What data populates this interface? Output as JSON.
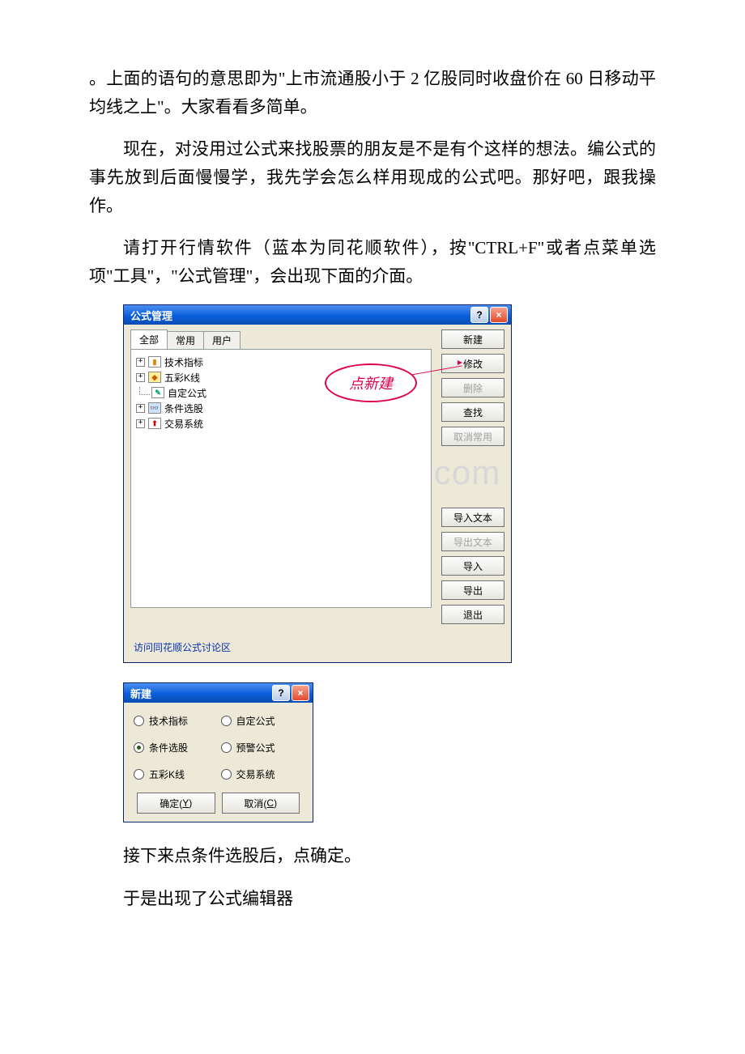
{
  "paragraphs": {
    "p1": "。上面的语句的意思即为\"上市流通股小于 2 亿股同时收盘价在 60 日移动平均线之上\"。大家看看多简单。",
    "p2": "现在，对没用过公式来找股票的朋友是不是有个这样的想法。编公式的事先放到后面慢慢学，我先学会怎么样用现成的公式吧。那好吧，跟我操作。",
    "p3": "请打开行情软件（蓝本为同花顺软件），按\"CTRL+F\"或者点菜单选项\"工具\"，\"公式管理\"，会出现下面的介面。",
    "p4": "接下来点条件选股后，点确定。",
    "p5": "于是出现了公式编辑器"
  },
  "watermark": "www.bdocx.com",
  "dialog1": {
    "title": "公式管理",
    "tabs": [
      "全部",
      "常用",
      "用户"
    ],
    "active_tab_index": 0,
    "tree": [
      {
        "label": "技术指标",
        "icon_class": "ico-chart",
        "has_children": true
      },
      {
        "label": "五彩K线",
        "icon_class": "ico-color",
        "has_children": true
      },
      {
        "label": "自定公式",
        "icon_class": "ico-edit",
        "has_children": false
      },
      {
        "label": "条件选股",
        "icon_class": "ico-find",
        "has_children": true
      },
      {
        "label": "交易系统",
        "icon_class": "ico-trade",
        "has_children": true
      }
    ],
    "group1": [
      {
        "label": "新建",
        "disabled": false
      },
      {
        "label": "修改",
        "disabled": false
      },
      {
        "label": "删除",
        "disabled": true
      },
      {
        "label": "查找",
        "disabled": false
      },
      {
        "label": "取消常用",
        "disabled": true
      }
    ],
    "group2": [
      {
        "label": "导入文本",
        "disabled": false
      },
      {
        "label": "导出文本",
        "disabled": true
      },
      {
        "label": "导入",
        "disabled": false
      },
      {
        "label": "导出",
        "disabled": false
      },
      {
        "label": "退出",
        "disabled": false
      }
    ],
    "footer_link": "访问同花顺公式讨论区",
    "annotation": "点新建"
  },
  "dialog2": {
    "title": "新建",
    "options": [
      {
        "label": "技术指标",
        "selected": false
      },
      {
        "label": "自定公式",
        "selected": false
      },
      {
        "label": "条件选股",
        "selected": true
      },
      {
        "label": "预警公式",
        "selected": false
      },
      {
        "label": "五彩K线",
        "selected": false
      },
      {
        "label": "交易系统",
        "selected": false
      }
    ],
    "ok": {
      "text": "确定(",
      "key": "Y",
      "suffix": ")"
    },
    "cancel": {
      "text": "取消(",
      "key": "C",
      "suffix": ")"
    }
  }
}
